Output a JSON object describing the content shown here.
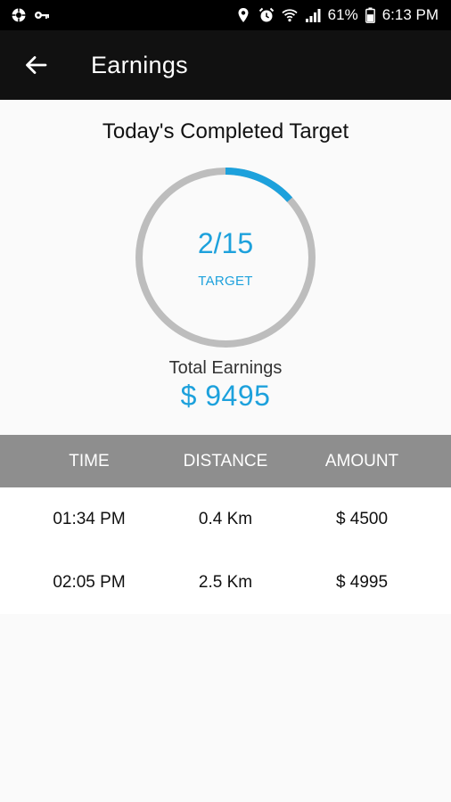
{
  "status_bar": {
    "battery": "61%",
    "time": "6:13 PM",
    "icons_left": [
      "app-notification-icon",
      "key-icon"
    ],
    "icons_right": [
      "location-icon",
      "alarm-icon",
      "wifi-icon",
      "signal-icon",
      "battery-icon"
    ]
  },
  "app_bar": {
    "title": "Earnings",
    "back_icon": "arrow-left-icon"
  },
  "target": {
    "heading": "Today's Completed Target",
    "count": "2/15",
    "label": "TARGET",
    "completed": 2,
    "total": 15,
    "progress_color": "#1da1dc",
    "track_color": "#bdbdbd"
  },
  "earnings": {
    "label": "Total Earnings",
    "value": "$ 9495"
  },
  "table": {
    "headers": [
      "TIME",
      "DISTANCE",
      "AMOUNT"
    ],
    "rows": [
      {
        "time": "01:34 PM",
        "distance": "0.4 Km",
        "amount": "$ 4500"
      },
      {
        "time": "02:05 PM",
        "distance": "2.5 Km",
        "amount": "$ 4995"
      }
    ]
  },
  "colors": {
    "accent": "#1da1dc",
    "app_bar": "#111111",
    "table_header": "#8e8e8e"
  }
}
